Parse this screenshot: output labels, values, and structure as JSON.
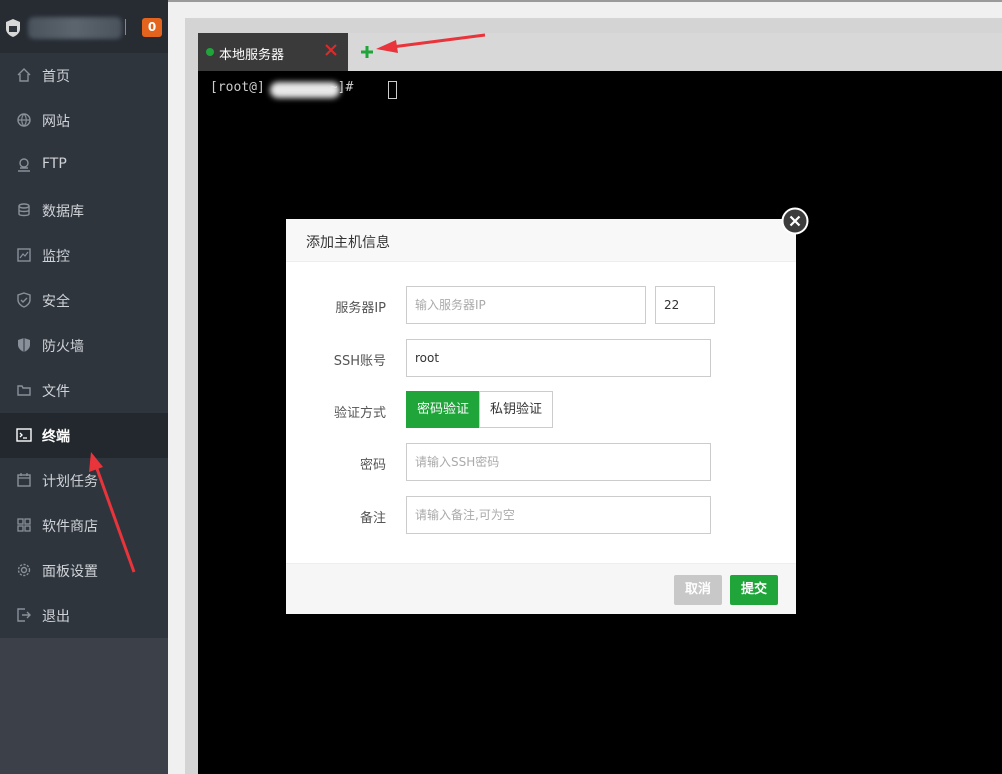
{
  "sidebar": {
    "badge_count": "0",
    "items": [
      {
        "label": "首页",
        "icon": "home-icon"
      },
      {
        "label": "网站",
        "icon": "globe-icon"
      },
      {
        "label": "FTP",
        "icon": "ftp-icon"
      },
      {
        "label": "数据库",
        "icon": "database-icon"
      },
      {
        "label": "监控",
        "icon": "monitor-icon"
      },
      {
        "label": "安全",
        "icon": "shield-check-icon"
      },
      {
        "label": "防火墙",
        "icon": "shield-icon"
      },
      {
        "label": "文件",
        "icon": "folder-icon"
      },
      {
        "label": "终端",
        "icon": "terminal-icon",
        "active": true
      },
      {
        "label": "计划任务",
        "icon": "calendar-icon"
      },
      {
        "label": "软件商店",
        "icon": "grid-icon"
      },
      {
        "label": "面板设置",
        "icon": "gear-icon"
      },
      {
        "label": "退出",
        "icon": "logout-icon"
      }
    ]
  },
  "tabs": [
    {
      "label": "本地服务器",
      "status": "connected"
    }
  ],
  "terminal": {
    "prompt_start": "[root@]",
    "prompt_end": "~]# "
  },
  "modal": {
    "title": "添加主机信息",
    "fields": {
      "server_ip": {
        "label": "服务器IP",
        "placeholder": "输入服务器IP",
        "value": ""
      },
      "port": {
        "value": "22"
      },
      "ssh_account": {
        "label": "SSH账号",
        "value": "root"
      },
      "auth_method": {
        "label": "验证方式",
        "options": [
          "密码验证",
          "私钥验证"
        ],
        "selected": "密码验证"
      },
      "password": {
        "label": "密码",
        "placeholder": "请输入SSH密码",
        "value": ""
      },
      "note": {
        "label": "备注",
        "placeholder": "请输入备注,可为空",
        "value": ""
      }
    },
    "buttons": {
      "cancel": "取消",
      "submit": "提交"
    }
  },
  "colors": {
    "sidebar_bg": "#2f353d",
    "accent_green": "#20a53a",
    "badge_orange": "#e5641d",
    "annotation_red": "#e8343a"
  }
}
